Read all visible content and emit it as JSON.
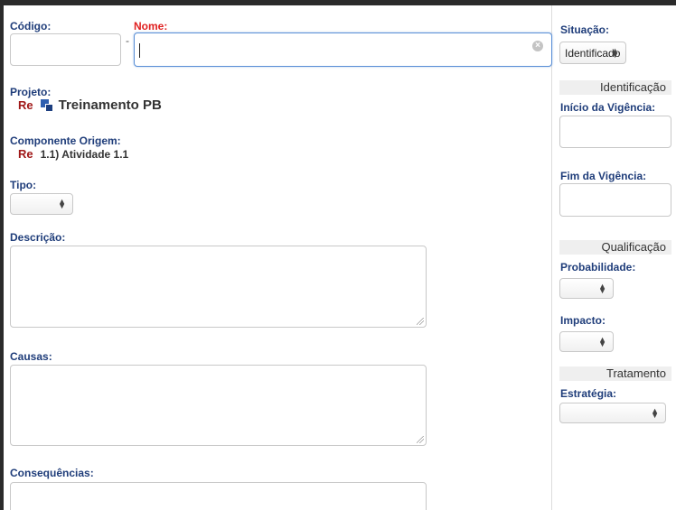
{
  "main": {
    "codigo": {
      "label": "Código:",
      "value": ""
    },
    "separator": "-",
    "nome": {
      "label": "Nome:",
      "value": ""
    },
    "projeto": {
      "label": "Projeto:",
      "badge": "Re",
      "name": "Treinamento PB",
      "icon": "project-icon"
    },
    "componente": {
      "label": "Componente Origem:",
      "badge": "Re",
      "name": "1.1) Atividade 1.1"
    },
    "tipo": {
      "label": "Tipo:",
      "selected": ""
    },
    "descricao": {
      "label": "Descrição:",
      "value": ""
    },
    "causas": {
      "label": "Causas:",
      "value": ""
    },
    "consequencias": {
      "label": "Consequências:",
      "value": ""
    }
  },
  "sidebar": {
    "situacao": {
      "label": "Situação:",
      "selected": "Identificado"
    },
    "identificacao": {
      "header": "Identificação",
      "inicio_label": "Início da Vigência:",
      "fim_label": "Fim da Vigência:"
    },
    "qualificacao": {
      "header": "Qualificação",
      "probabilidade_label": "Probabilidade:",
      "impacto_label": "Impacto:"
    },
    "tratamento": {
      "header": "Tratamento",
      "estrategia_label": "Estratégia:"
    }
  },
  "colors": {
    "label": "#1f3d7a",
    "required": "#e02020",
    "badge": "#a01818",
    "focus_border": "#5a8fd6"
  }
}
